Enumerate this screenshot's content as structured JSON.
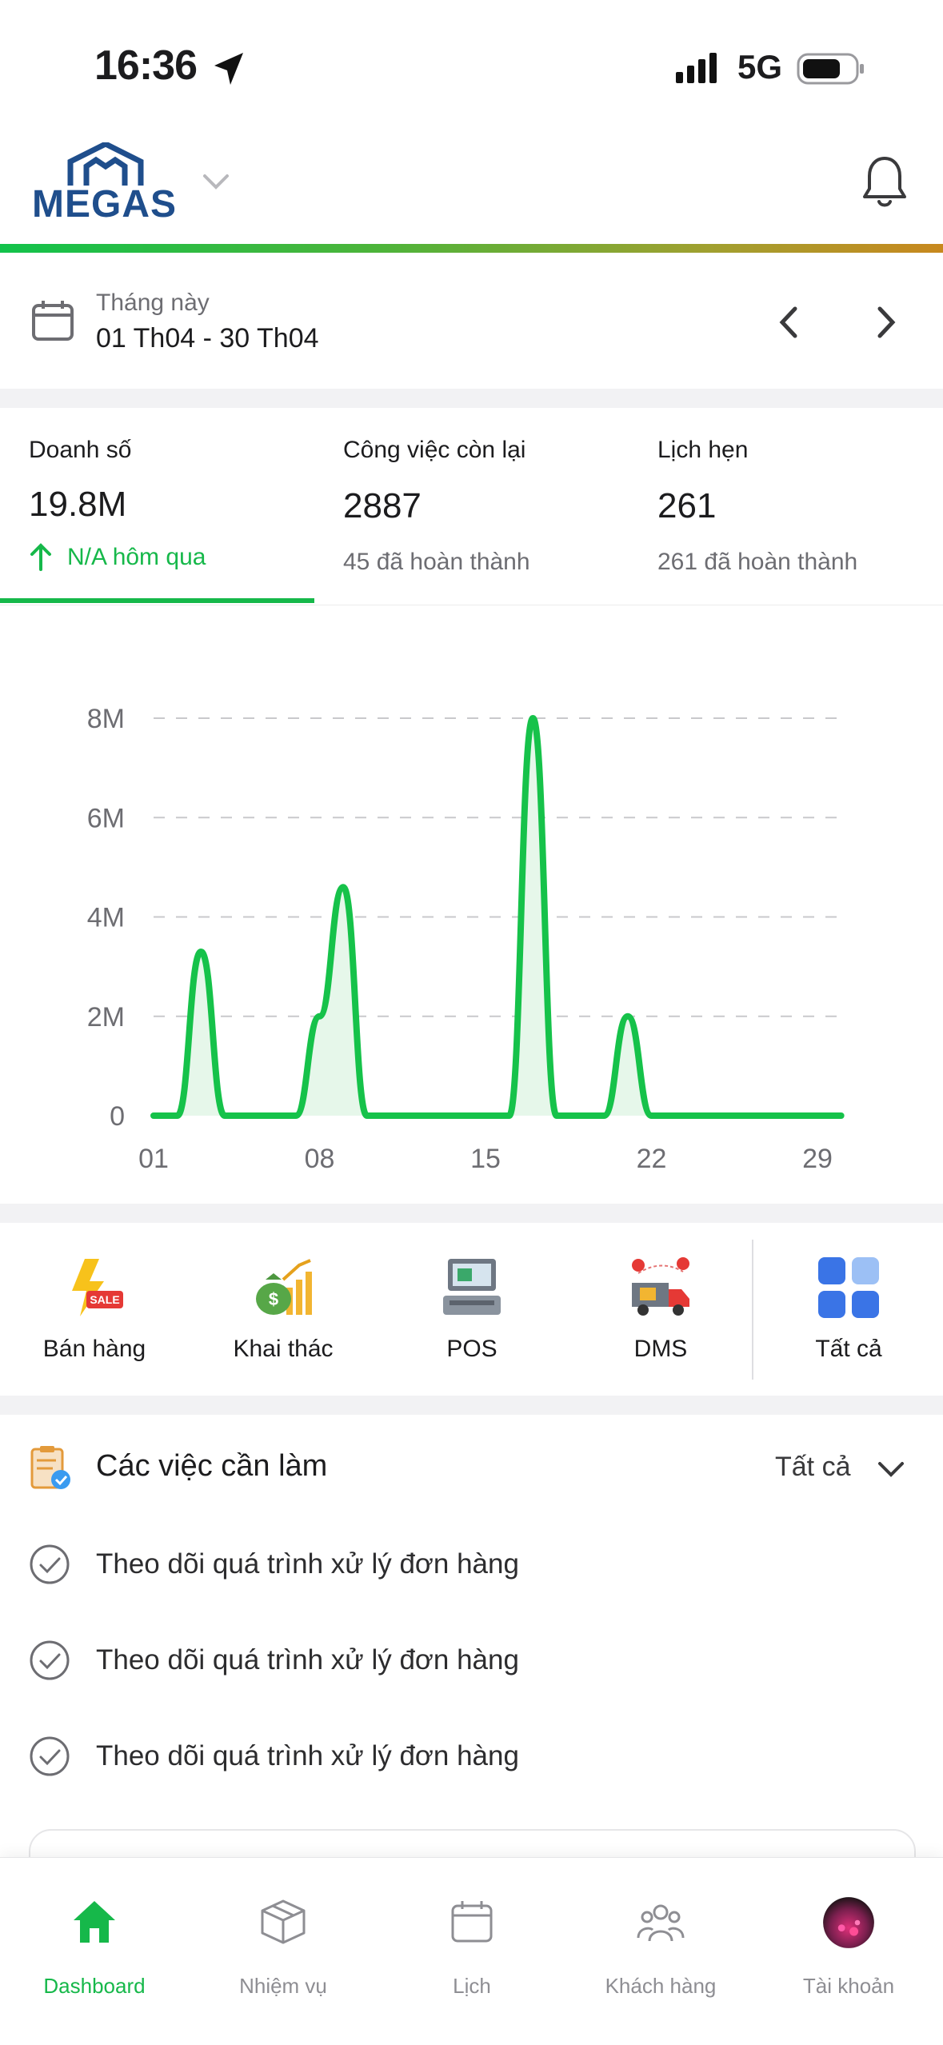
{
  "status_bar": {
    "time": "16:36",
    "network": "5G"
  },
  "header": {
    "logo_text": "MEGAS"
  },
  "date_range": {
    "label": "Tháng này",
    "value": "01 Th04 - 30 Th04"
  },
  "kpis": [
    {
      "title": "Doanh số",
      "value": "19.8M",
      "sub": "N/A hôm qua"
    },
    {
      "title": "Công việc còn lại",
      "value": "2887",
      "sub": "45 đã hoàn thành"
    },
    {
      "title": "Lịch hẹn",
      "value": "261",
      "sub": "261 đã hoàn thành"
    }
  ],
  "chart_data": {
    "type": "area",
    "x_tick_labels": [
      "01",
      "08",
      "15",
      "22",
      "29"
    ],
    "y_tick_labels": [
      "0",
      "2M",
      "4M",
      "6M",
      "8M"
    ],
    "ylim": [
      0,
      8000000
    ],
    "x": [
      1,
      2,
      3,
      4,
      5,
      6,
      7,
      8,
      9,
      10,
      11,
      12,
      13,
      14,
      15,
      16,
      17,
      18,
      19,
      20,
      21,
      22,
      23,
      24,
      25,
      26,
      27,
      28,
      29,
      30
    ],
    "series": [
      {
        "values": [
          0,
          0,
          3300000,
          0,
          0,
          0,
          0,
          2000000,
          4600000,
          0,
          0,
          0,
          0,
          0,
          0,
          0,
          8000000,
          0,
          0,
          0,
          2000000,
          0,
          0,
          0,
          0,
          0,
          0,
          0,
          0,
          0
        ]
      }
    ],
    "grid": true,
    "line_color": "#16c24a",
    "fill_color": "#e6f7ea"
  },
  "quick_actions": [
    {
      "label": "Bán hàng",
      "icon": "sale-lightning-icon"
    },
    {
      "label": "Khai thác",
      "icon": "money-growth-icon"
    },
    {
      "label": "POS",
      "icon": "pos-terminal-icon"
    },
    {
      "label": "DMS",
      "icon": "delivery-truck-icon"
    },
    {
      "label": "Tất cả",
      "icon": "grid-apps-icon"
    }
  ],
  "todo": {
    "title": "Các việc cần làm",
    "filter": "Tất cả",
    "items": [
      "Theo dõi quá trình xử lý đơn hàng",
      "Theo dõi quá trình xử lý đơn hàng",
      "Theo dõi quá trình xử lý đơn hàng"
    ]
  },
  "bottom_nav": [
    {
      "label": "Dashboard",
      "icon": "home-icon",
      "active": true
    },
    {
      "label": "Nhiệm vụ",
      "icon": "box-icon",
      "active": false
    },
    {
      "label": "Lịch",
      "icon": "calendar-icon",
      "active": false
    },
    {
      "label": "Khách hàng",
      "icon": "customers-icon",
      "active": false
    },
    {
      "label": "Tài khoản",
      "icon": "avatar-icon",
      "active": false
    }
  ],
  "colors": {
    "accent": "#16b84a",
    "brand": "#1f4e8c"
  }
}
